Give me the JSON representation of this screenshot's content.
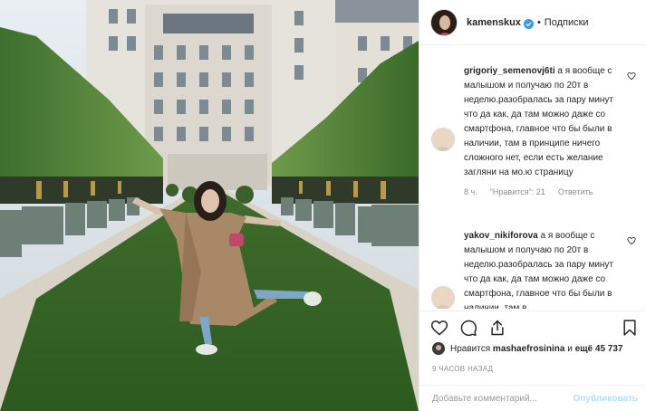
{
  "post": {
    "username": "kamenskux",
    "separator": "•",
    "follow_label": "Подписки"
  },
  "comments": [
    {
      "username": "grigoriy_semenovj6ti",
      "text": " а я вообще с малышом и получаю по 20т в неделю.разобралась за пару минут что да как, да там можно даже со смартфона, главное что бы были в наличии, там в принципе ничего сложного нет, если есть желание загляни на мо.ю страницу",
      "time": "8 ч.",
      "likes": "\"Нравится\": 21",
      "reply_label": "Ответить"
    },
    {
      "username": "yakov_nikiforova",
      "text": " а я вообще с малышом и получаю по 20т в неделю.разобралась за пару минут что да как, да там можно даже со смартфона, главное что бы были в наличии, там в"
    }
  ],
  "likes": {
    "prefix": "Нравится",
    "user": "mashaefrosinina",
    "middle": "и",
    "count": "ещё 45 737"
  },
  "time_ago": "9 ЧАСОВ НАЗАД",
  "comment_box": {
    "placeholder": "Добавьте комментарий...",
    "publish_label": "Опубликовать"
  },
  "icons": {
    "like": "heart-icon",
    "comment": "comment-icon",
    "share": "share-icon",
    "save": "bookmark-icon",
    "verified": "verified-badge-icon"
  },
  "colors": {
    "verified": "#3897f0",
    "publish": "#b2dffc",
    "muted": "#8e8e8e"
  }
}
